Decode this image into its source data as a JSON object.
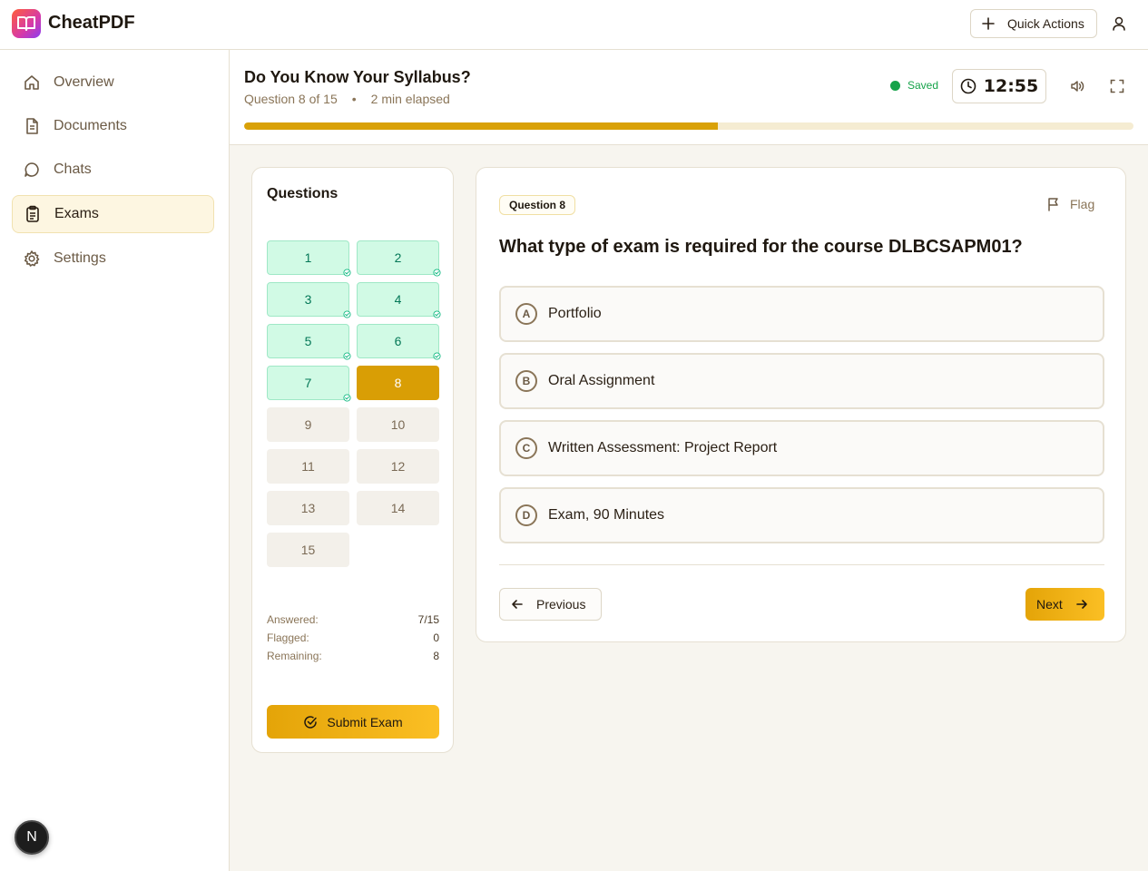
{
  "app": {
    "name": "CheatPDF"
  },
  "topbar": {
    "quick_actions_label": "Quick Actions"
  },
  "sidebar": {
    "items": [
      {
        "label": "Overview",
        "icon": "home-icon",
        "active": false
      },
      {
        "label": "Documents",
        "icon": "document-icon",
        "active": false
      },
      {
        "label": "Chats",
        "icon": "chat-icon",
        "active": false
      },
      {
        "label": "Exams",
        "icon": "clipboard-icon",
        "active": true
      },
      {
        "label": "Settings",
        "icon": "gear-icon",
        "active": false
      }
    ],
    "badge_letter": "N"
  },
  "exam": {
    "title": "Do You Know Your Syllabus?",
    "question_progress": "Question 8 of 15",
    "separator": "•",
    "elapsed": "2 min elapsed",
    "saved_label": "Saved",
    "timer": "12:55",
    "progress_percent": 53.3
  },
  "questions_panel": {
    "title": "Questions",
    "cells": [
      {
        "number": "1",
        "status": "answered"
      },
      {
        "number": "2",
        "status": "answered"
      },
      {
        "number": "3",
        "status": "answered"
      },
      {
        "number": "4",
        "status": "answered"
      },
      {
        "number": "5",
        "status": "answered"
      },
      {
        "number": "6",
        "status": "answered"
      },
      {
        "number": "7",
        "status": "answered"
      },
      {
        "number": "8",
        "status": "current"
      },
      {
        "number": "9",
        "status": "unanswered"
      },
      {
        "number": "10",
        "status": "unanswered"
      },
      {
        "number": "11",
        "status": "unanswered"
      },
      {
        "number": "12",
        "status": "unanswered"
      },
      {
        "number": "13",
        "status": "unanswered"
      },
      {
        "number": "14",
        "status": "unanswered"
      },
      {
        "number": "15",
        "status": "unanswered"
      }
    ],
    "stats": {
      "answered_label": "Answered:",
      "answered_value": "7/15",
      "flagged_label": "Flagged:",
      "flagged_value": "0",
      "remaining_label": "Remaining:",
      "remaining_value": "8"
    },
    "submit_label": "Submit Exam"
  },
  "question": {
    "badge": "Question 8",
    "flag_label": "Flag",
    "text": "What type of exam is required for the course DLBCSAPM01?",
    "options": [
      {
        "letter": "A",
        "text": "Portfolio"
      },
      {
        "letter": "B",
        "text": "Oral Assignment"
      },
      {
        "letter": "C",
        "text": "Written Assessment: Project Report"
      },
      {
        "letter": "D",
        "text": "Exam, 90 Minutes"
      }
    ],
    "previous_label": "Previous",
    "next_label": "Next"
  },
  "colors": {
    "accent": "#d99e05",
    "answered_bg": "#d1fae5",
    "saved_green": "#16a34a"
  }
}
